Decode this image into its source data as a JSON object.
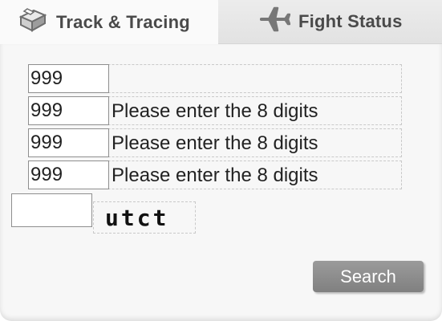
{
  "tabs": {
    "track": {
      "label": "Track & Tracing",
      "icon": "mailbox-icon",
      "active": true
    },
    "flight": {
      "label": "Fight Status",
      "icon": "airplane-icon",
      "active": false
    }
  },
  "form": {
    "rows": [
      {
        "value": "999",
        "hint": ""
      },
      {
        "value": "999",
        "hint": "Please enter the 8 digits"
      },
      {
        "value": "999",
        "hint": "Please enter the 8 digits"
      },
      {
        "value": "999",
        "hint": "Please enter the 8 digits"
      }
    ],
    "captcha": {
      "input_value": "",
      "code": "utct"
    },
    "search_label": "Search"
  },
  "colors": {
    "button": "#8a8a8a",
    "panel": "#f7f7f7",
    "inactive_tab": "#e6e6e6"
  }
}
